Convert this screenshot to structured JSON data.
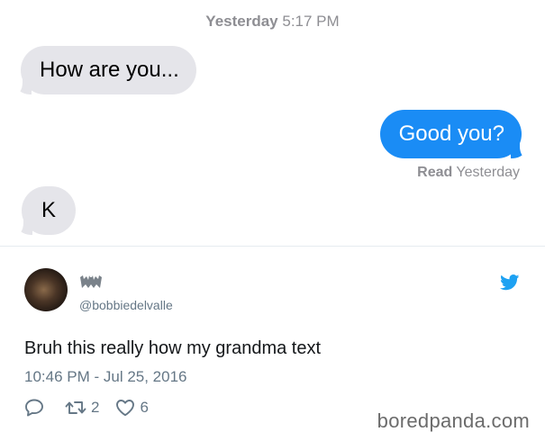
{
  "conversation": {
    "timestamp_day": "Yesterday",
    "timestamp_time": "5:17 PM",
    "messages": [
      {
        "text": "How are you...",
        "direction": "incoming"
      },
      {
        "text": "Good you?",
        "direction": "outgoing"
      },
      {
        "text": "K",
        "direction": "incoming"
      }
    ],
    "read_label": "Read",
    "read_time": "Yesterday"
  },
  "tweet": {
    "handle": "@bobbiedelvalle",
    "text": "Bruh this really how my grandma text",
    "timestamp": "10:46 PM - Jul 25, 2016",
    "retweets": "2",
    "likes": "6"
  },
  "watermark": "boredpanda.com",
  "colors": {
    "incoming_bubble": "#e5e5ea",
    "outgoing_bubble": "#1a8cf5",
    "twitter_blue": "#1da1f2",
    "meta_gray": "#657786"
  }
}
